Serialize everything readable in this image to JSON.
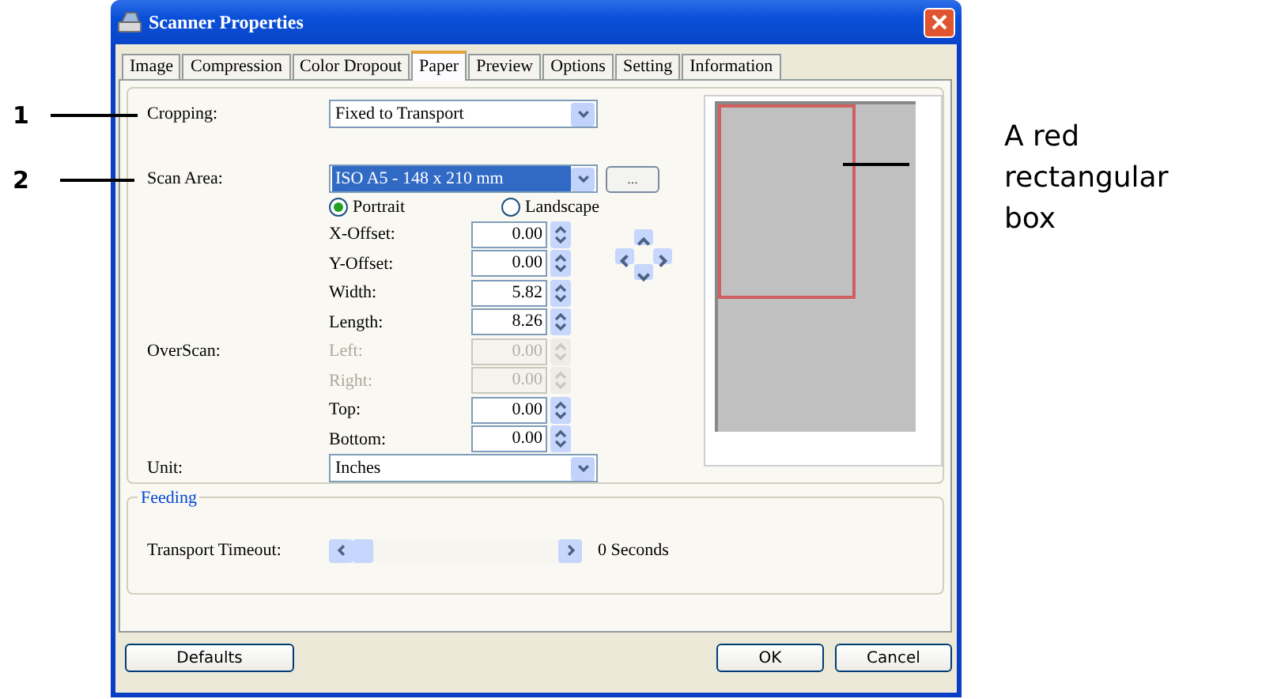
{
  "callouts": [
    {
      "label": "1"
    },
    {
      "label": "2"
    }
  ],
  "annotation": "A red rectangular box",
  "window": {
    "title": "Scanner Properties"
  },
  "tabs": [
    {
      "label": "Image",
      "selected": false
    },
    {
      "label": "Compression",
      "selected": false
    },
    {
      "label": "Color Dropout",
      "selected": false
    },
    {
      "label": "Paper",
      "selected": true
    },
    {
      "label": "Preview",
      "selected": false
    },
    {
      "label": "Options",
      "selected": false
    },
    {
      "label": "Setting",
      "selected": false
    },
    {
      "label": "Information",
      "selected": false
    }
  ],
  "settings": [
    {
      "kind": "select",
      "label": "Cropping:",
      "value": "Fixed to Transport",
      "highlighted": false
    },
    {
      "kind": "select",
      "label": "Scan Area:",
      "value": "ISO A5 - 148 x 210 mm",
      "highlighted": true,
      "button": "..."
    }
  ],
  "orientation": [
    {
      "label": "Portrait",
      "selected": true
    },
    {
      "label": "Landscape",
      "selected": false
    }
  ],
  "spins": [
    {
      "label": "X-Offset:",
      "value": "0.00",
      "disabled": false
    },
    {
      "label": "Y-Offset:",
      "value": "0.00",
      "disabled": false
    },
    {
      "label": "Width:",
      "value": "5.82",
      "disabled": false
    },
    {
      "label": "Length:",
      "value": "8.26",
      "disabled": false
    },
    {
      "group_label": "OverScan:",
      "label": "Left:",
      "value": "0.00",
      "disabled": true
    },
    {
      "label": "Right:",
      "value": "0.00",
      "disabled": true
    },
    {
      "label": "Top:",
      "value": "0.00",
      "disabled": false
    },
    {
      "label": "Bottom:",
      "value": "0.00",
      "disabled": false
    }
  ],
  "unit": {
    "label": "Unit:",
    "value": "Inches",
    "highlighted": false
  },
  "feeding": {
    "title": "Feeding",
    "label": "Transport Timeout:",
    "level": 0,
    "reading": "0 Seconds"
  },
  "buttons": [
    {
      "label": "Defaults",
      "kind": "left"
    },
    {
      "label": "OK",
      "kind": "right"
    },
    {
      "label": "Cancel",
      "kind": "right"
    }
  ]
}
